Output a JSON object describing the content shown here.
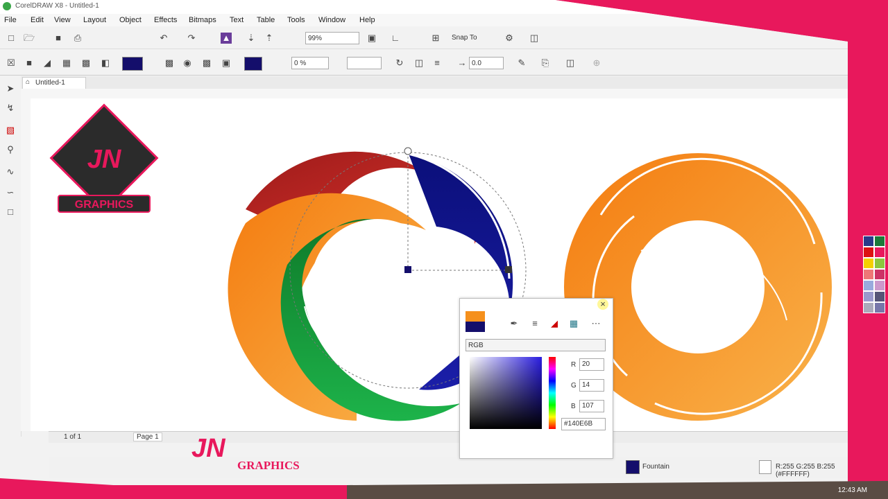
{
  "window": {
    "title": "CorelDRAW X8 - Untitled-1"
  },
  "menu": [
    "File",
    "Edit",
    "View",
    "Layout",
    "Object",
    "Effects",
    "Bitmaps",
    "Text",
    "Table",
    "Tools",
    "Window",
    "Help"
  ],
  "toolbar": {
    "zoom": "99%",
    "snap_to": "Snap To"
  },
  "property_bar": {
    "opacity": "0 %",
    "angle": "0.0"
  },
  "document_tab": "Untitled-1",
  "page_nav": {
    "counter": "1 of 1",
    "page_tab": "Page 1"
  },
  "color_popup": {
    "model": "RGB",
    "r_label": "R",
    "r": "20",
    "g_label": "G",
    "g": "14",
    "b_label": "B",
    "b": "107",
    "hex": "#140E6B"
  },
  "status": {
    "fill_type": "Fountain",
    "outline_info": "R:255 G:255 B:255 (#FFFFFF)",
    "clock": "12:43 AM"
  },
  "watermark": {
    "brand_top": "JN",
    "brand_label": "GRAPHICS"
  },
  "colors": {
    "accent_pink": "#e8185c",
    "ring_red": "#c0261c",
    "ring_orange": "#f5901c",
    "ring_green": "#159a3a",
    "ring_blue": "#140E6B"
  },
  "icons": [
    "new-icon",
    "open-icon",
    "save-icon",
    "print-icon",
    "undo-icon",
    "redo-icon",
    "import-icon",
    "export-icon",
    "zoom-icon",
    "gear-icon",
    "pick-tool-icon",
    "shape-tool-icon",
    "zoom-tool-icon",
    "eyedropper-icon",
    "close-icon"
  ]
}
